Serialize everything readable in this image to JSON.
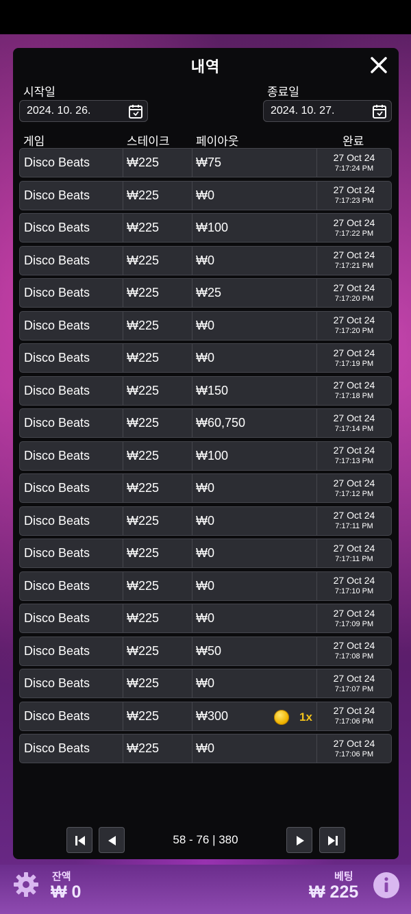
{
  "header": {
    "title": "내역"
  },
  "filters": {
    "start_label": "시작일",
    "start_value": "2024. 10. 26.",
    "end_label": "종료일",
    "end_value": "2024. 10. 27."
  },
  "columns": {
    "game": "게임",
    "stake": "스테이크",
    "payout": "페이아웃",
    "completed": "완료"
  },
  "rows": [
    {
      "game": "Disco Beats",
      "stake": "₩225",
      "payout": "₩75",
      "date": "27 Oct 24",
      "time": "7:17:24 PM"
    },
    {
      "game": "Disco Beats",
      "stake": "₩225",
      "payout": "₩0",
      "date": "27 Oct 24",
      "time": "7:17:23 PM"
    },
    {
      "game": "Disco Beats",
      "stake": "₩225",
      "payout": "₩100",
      "date": "27 Oct 24",
      "time": "7:17:22 PM"
    },
    {
      "game": "Disco Beats",
      "stake": "₩225",
      "payout": "₩0",
      "date": "27 Oct 24",
      "time": "7:17:21 PM"
    },
    {
      "game": "Disco Beats",
      "stake": "₩225",
      "payout": "₩25",
      "date": "27 Oct 24",
      "time": "7:17:20 PM"
    },
    {
      "game": "Disco Beats",
      "stake": "₩225",
      "payout": "₩0",
      "date": "27 Oct 24",
      "time": "7:17:20 PM"
    },
    {
      "game": "Disco Beats",
      "stake": "₩225",
      "payout": "₩0",
      "date": "27 Oct 24",
      "time": "7:17:19 PM"
    },
    {
      "game": "Disco Beats",
      "stake": "₩225",
      "payout": "₩150",
      "date": "27 Oct 24",
      "time": "7:17:18 PM"
    },
    {
      "game": "Disco Beats",
      "stake": "₩225",
      "payout": "₩60,750",
      "date": "27 Oct 24",
      "time": "7:17:14 PM"
    },
    {
      "game": "Disco Beats",
      "stake": "₩225",
      "payout": "₩100",
      "date": "27 Oct 24",
      "time": "7:17:13 PM"
    },
    {
      "game": "Disco Beats",
      "stake": "₩225",
      "payout": "₩0",
      "date": "27 Oct 24",
      "time": "7:17:12 PM"
    },
    {
      "game": "Disco Beats",
      "stake": "₩225",
      "payout": "₩0",
      "date": "27 Oct 24",
      "time": "7:17:11 PM"
    },
    {
      "game": "Disco Beats",
      "stake": "₩225",
      "payout": "₩0",
      "date": "27 Oct 24",
      "time": "7:17:11 PM"
    },
    {
      "game": "Disco Beats",
      "stake": "₩225",
      "payout": "₩0",
      "date": "27 Oct 24",
      "time": "7:17:10 PM"
    },
    {
      "game": "Disco Beats",
      "stake": "₩225",
      "payout": "₩0",
      "date": "27 Oct 24",
      "time": "7:17:09 PM"
    },
    {
      "game": "Disco Beats",
      "stake": "₩225",
      "payout": "₩50",
      "date": "27 Oct 24",
      "time": "7:17:08 PM"
    },
    {
      "game": "Disco Beats",
      "stake": "₩225",
      "payout": "₩0",
      "date": "27 Oct 24",
      "time": "7:17:07 PM"
    },
    {
      "game": "Disco Beats",
      "stake": "₩225",
      "payout": "₩300",
      "multiplier": "1x",
      "date": "27 Oct 24",
      "time": "7:17:06 PM"
    },
    {
      "game": "Disco Beats",
      "stake": "₩225",
      "payout": "₩0",
      "date": "27 Oct 24",
      "time": "7:17:06 PM"
    }
  ],
  "pagination": {
    "info": "58 - 76 | 380"
  },
  "footer": {
    "balance_label": "잔액",
    "balance_value": "₩ 0",
    "bet_label": "베팅",
    "bet_value": "₩ 225"
  }
}
